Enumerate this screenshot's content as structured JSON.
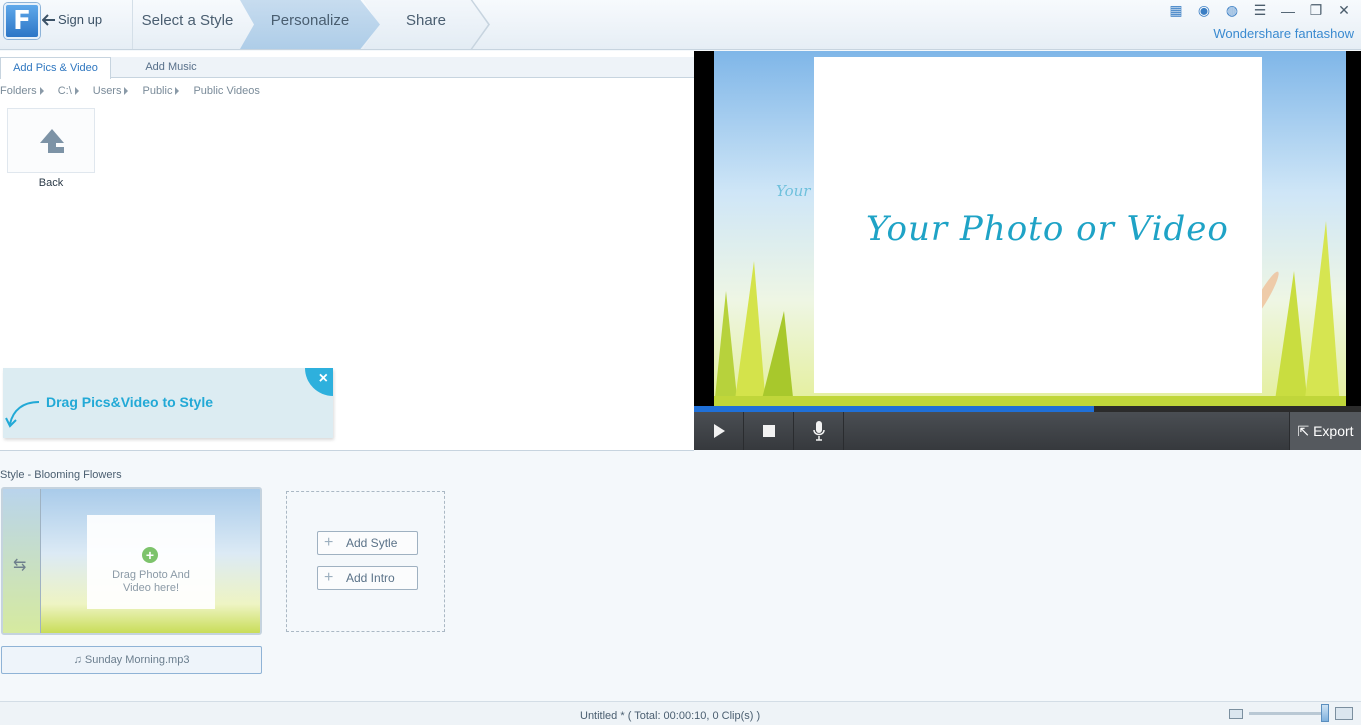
{
  "app": {
    "logo_letter": "F",
    "signup_label": "Sign up",
    "brand": "Wondershare fantashow"
  },
  "steps": [
    "Select a Style",
    "Personalize",
    "Share"
  ],
  "left_panel": {
    "tabs": [
      "Add Pics & Video",
      "Add Music"
    ],
    "breadcrumb": [
      "Folders",
      "C:\\",
      "Users",
      "Public",
      "Public Videos"
    ],
    "back_label": "Back",
    "drag_tip": "Drag Pics&Video to Style"
  },
  "preview": {
    "title_text": "Your Photo or Video",
    "small_text": "Your",
    "progress": 0.6,
    "export_label": "Export"
  },
  "storyboard": {
    "style_label": "Style - Blooming Flowers",
    "drop_hint_line1": "Drag Photo And",
    "drop_hint_line2": "Video here!",
    "music_file": "Sunday Morning.mp3",
    "add_style_label": "Add Sytle",
    "add_intro_label": "Add Intro"
  },
  "status": {
    "text": "Untitled *    ( Total: 00:00:10, 0 Clip(s) )"
  },
  "colors": {
    "accent": "#2f77c0",
    "tip": "#22a9d6",
    "progress": "#1f70d8"
  }
}
